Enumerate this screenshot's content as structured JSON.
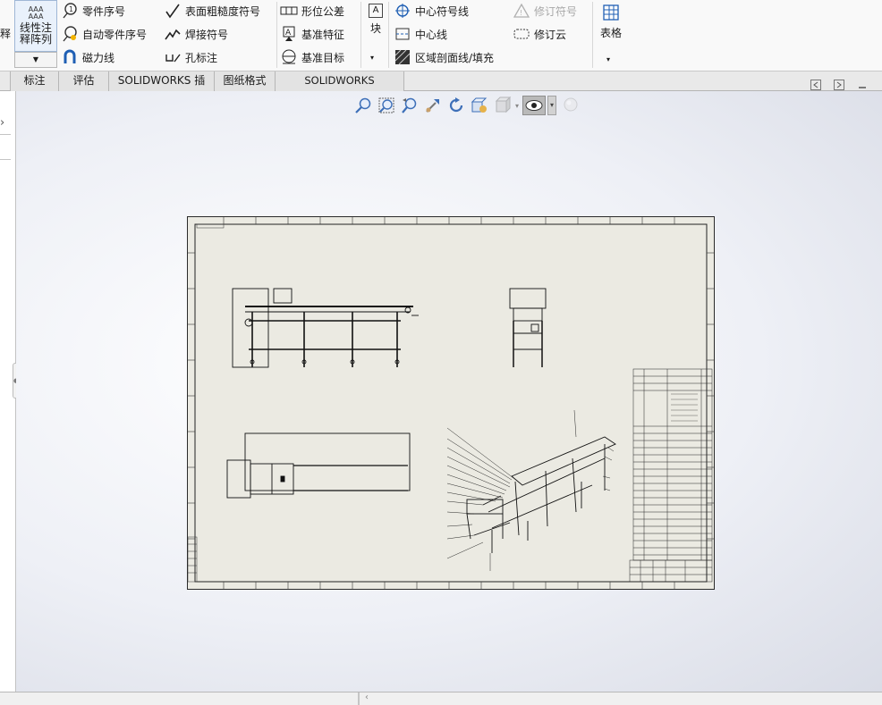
{
  "ribbon": {
    "left_partial": {
      "label": "释"
    },
    "linear_note": {
      "line1": "线性注",
      "line2": "释阵列"
    },
    "col1": [
      "零件序号",
      "自动零件序号",
      "磁力线"
    ],
    "col2": [
      "表面粗糙度符号",
      "焊接符号",
      "孔标注"
    ],
    "col3": [
      "形位公差",
      "基准特征",
      "基准目标"
    ],
    "block": {
      "label": "块"
    },
    "col4": [
      "中心符号线",
      "中心线",
      "区域剖面线/填充"
    ],
    "col5": [
      "修订符号",
      "修订云"
    ],
    "table": {
      "label": "表格"
    }
  },
  "tabs": [
    "标注",
    "评估",
    "SOLIDWORKS 插件",
    "图纸格式",
    "SOLIDWORKS Inspection"
  ],
  "hud_icons": [
    "zoom-to-fit-icon",
    "zoom-to-area-icon",
    "zoom-in-out-icon",
    "pan-icon",
    "rotate-icon",
    "view-orientation-icon",
    "display-style-icon",
    "hide-show-items-icon",
    "edit-appearance-icon"
  ],
  "colors": {
    "accent": "#1f5fb4",
    "sheet": "#ebeae2",
    "ribbon": "#f9f9f9"
  }
}
